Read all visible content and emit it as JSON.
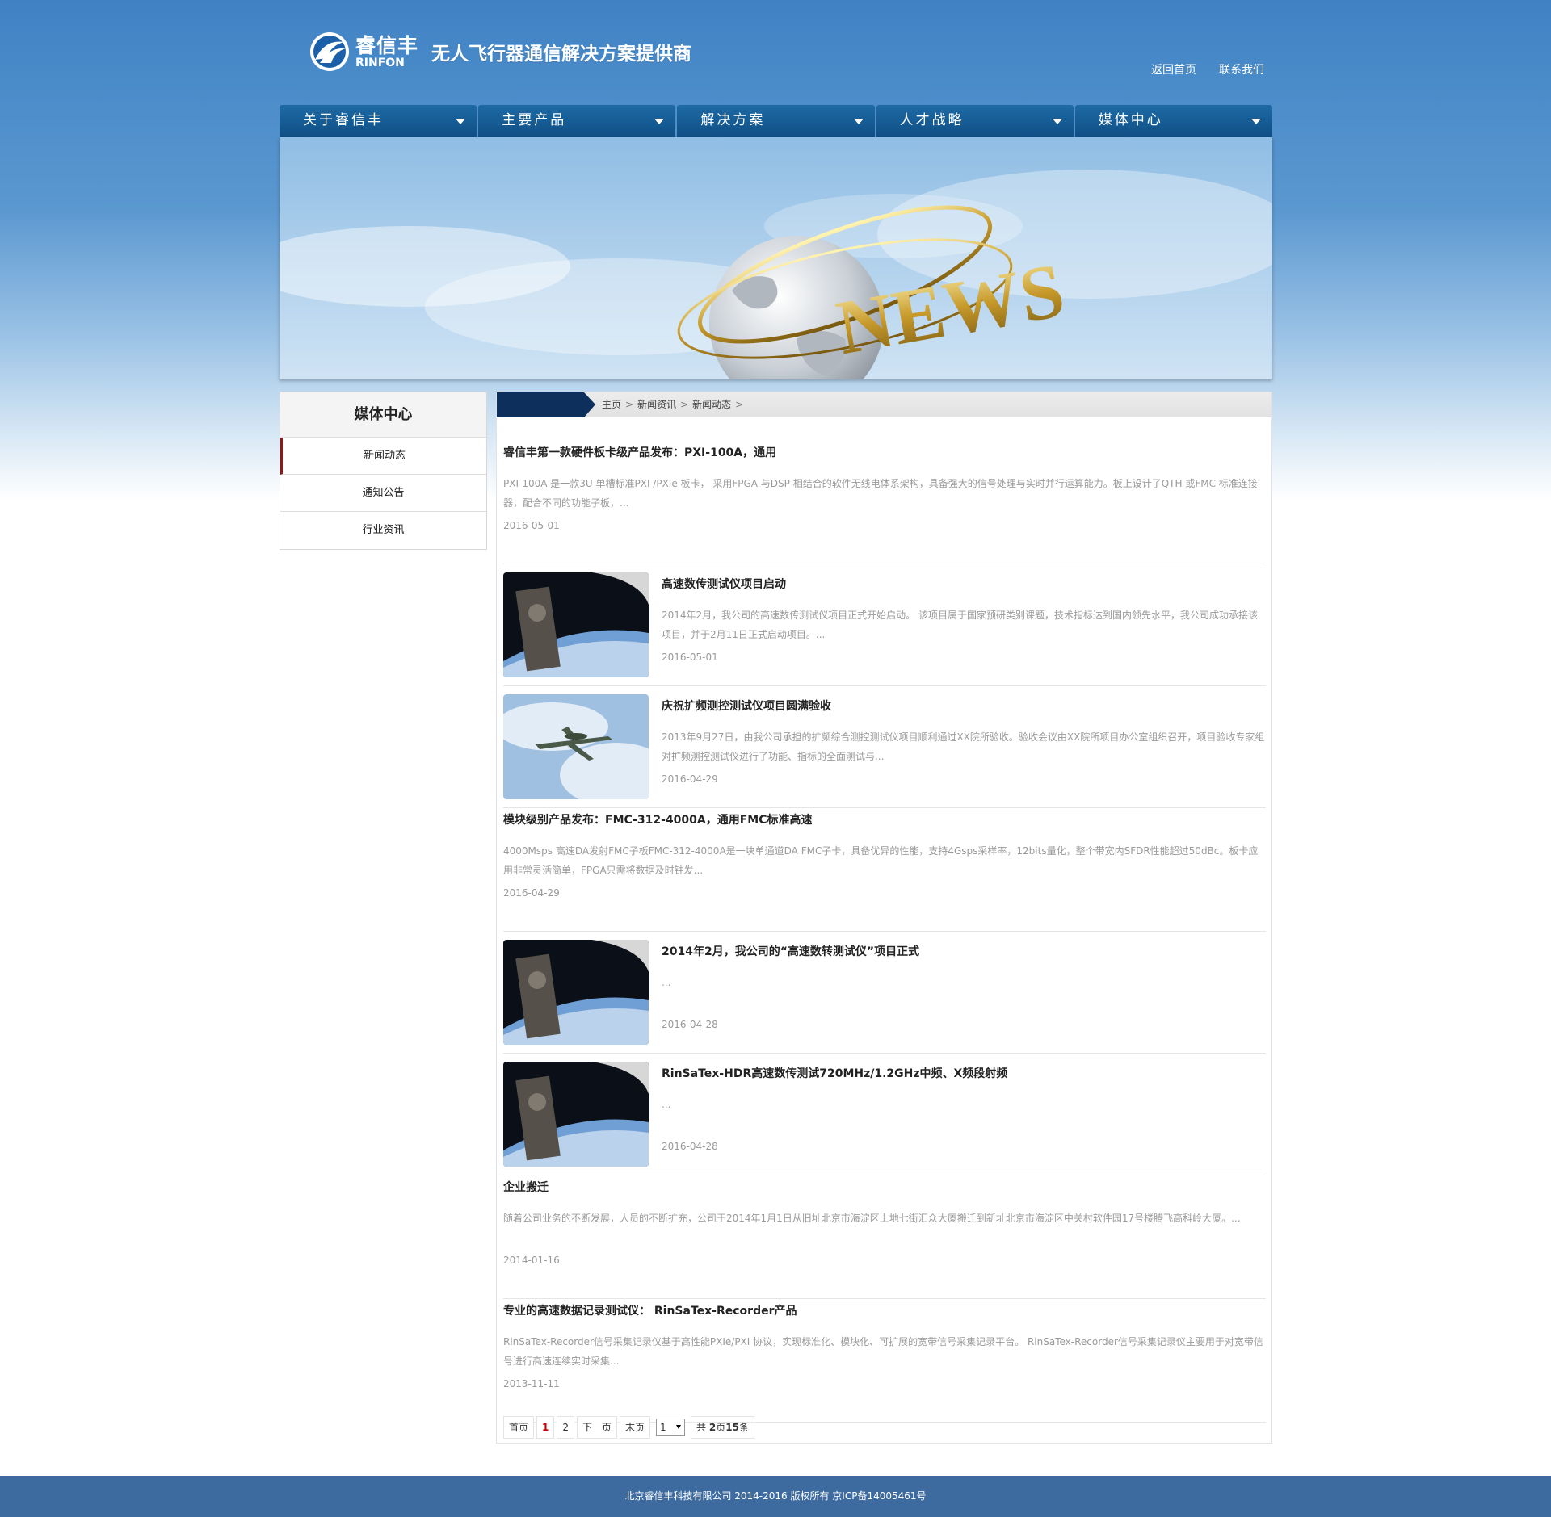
{
  "header": {
    "logo_cn": "睿信丰",
    "logo_en": "RINFON",
    "slogan": "无人飞行器通信解决方案提供商",
    "links": [
      "返回首页",
      "联系我们"
    ]
  },
  "nav": [
    "关于睿信丰",
    "主要产品",
    "解决方案",
    "人才战略",
    "媒体中心"
  ],
  "banner": {
    "word": "NEWS"
  },
  "sidebar": {
    "title": "媒体中心",
    "items": [
      "新闻动态",
      "通知公告",
      "行业资讯"
    ],
    "active": 0
  },
  "breadcrumb": {
    "home": "主页",
    "level1": "新闻资讯",
    "level2": "新闻动态",
    "sep": ">"
  },
  "news": [
    {
      "title": "睿信丰第一款硬件板卡级产品发布：PXI-100A，通用",
      "desc": "PXI-100A 是一款3U 单槽标准PXI /PXIe 板卡， 采用FPGA 与DSP 相结合的软件无线电体系架构，具备强大的信号处理与实时并行运算能力。板上设计了QTH 或FMC 标准连接器，配合不同的功能子板，...",
      "date": "2016-05-01",
      "image": "none"
    },
    {
      "title": "高速数传测试仪项目启动",
      "desc": "2014年2月，我公司的高速数传测试仪项目正式开始启动。 该项目属于国家预研类别课题，技术指标达到国内领先水平，我公司成功承接该项目，并于2月11日正式启动项目。...",
      "date": "2016-05-01",
      "image": "satellite-photo"
    },
    {
      "title": "庆祝扩频测控测试仪项目圆满验收",
      "desc": "2013年9月27日，由我公司承担的扩频综合测控测试仪项目顺利通过XX院所验收。验收会议由XX院所项目办公室组织召开，项目验收专家组对扩频测控测试仪进行了功能、指标的全面测试与...",
      "date": "2016-04-29",
      "image": "aircraft-photo"
    },
    {
      "title": "模块级别产品发布：FMC-312-4000A，通用FMC标准高速",
      "desc": "4000Msps 高速DA发射FMC子板FMC-312-4000A是一块单通道DA FMC子卡，具备优异的性能，支持4Gsps采样率，12bits量化，整个带宽内SFDR性能超过50dBc。板卡应用非常灵活简单，FPGA只需将数据及时钟发...",
      "date": "2016-04-29",
      "image": "none"
    },
    {
      "title": "2014年2月，我公司的“高速数转测试仪”项目正式",
      "desc": "...",
      "date": "2016-04-28",
      "image": "satellite-photo"
    },
    {
      "title": "RinSaTex-HDR高速数传测试720MHz/1.2GHz中频、X频段射频",
      "desc": "...",
      "date": "2016-04-28",
      "image": "satellite-photo"
    },
    {
      "title": "企业搬迁",
      "desc": "随着公司业务的不断发展，人员的不断扩充，公司于2014年1月1日从旧址北京市海淀区上地七街汇众大厦搬迁到新址北京市海淀区中关村软件园17号楼腾飞高科岭大厦。...",
      "date": "2014-01-16",
      "image": "none"
    },
    {
      "title": "专业的高速数据记录测试仪： RinSaTex-Recorder产品",
      "desc": "RinSaTex-Recorder信号采集记录仪基于高性能PXIe/PXI 协议，实现标准化、模块化、可扩展的宽带信号采集记录平台。 RinSaTex-Recorder信号采集记录仪主要用于对宽带信号进行高速连续实时采集...",
      "date": "2013-11-11",
      "image": "none"
    }
  ],
  "pager": {
    "first": "首页",
    "pages": [
      "1",
      "2"
    ],
    "current": "1",
    "next": "下一页",
    "last": "末页",
    "select_value": "1",
    "total_prefix": "共",
    "total_pages": "2",
    "pages_unit": "页",
    "total_items": "15",
    "items_unit": "条"
  },
  "footer": {
    "text": "北京睿信丰科技有限公司 2014-2016 版权所有 京ICP备14005461号"
  },
  "colors": {
    "nav": "#0f4f85",
    "footer": "#3d6b9f",
    "crumb_tab": "#0d2f5c",
    "active_marker": "#8b1a1a",
    "pager_current": "#cc0000"
  }
}
